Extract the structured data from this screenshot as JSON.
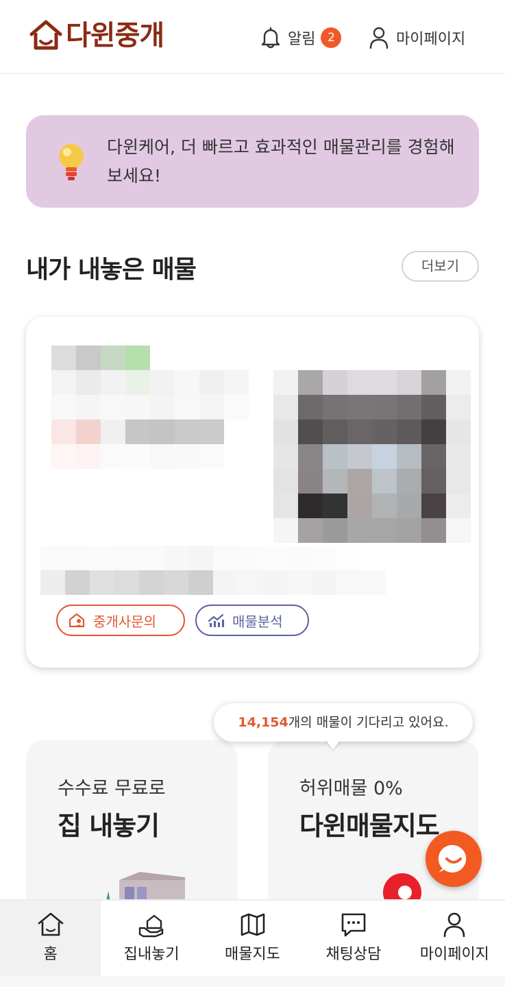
{
  "header": {
    "logo_text": "다윈중개",
    "alarm_label": "알림",
    "alarm_count": "2",
    "mypage_label": "마이페이지"
  },
  "promo": {
    "text": "다윈케어, 더 빠르고 효과적인 매물관리를 경험해보세요!"
  },
  "my_listings": {
    "title": "내가 내놓은 매물",
    "more_label": "더보기",
    "card": {
      "office_inquiry_label": "중개사문의",
      "analysis_label": "매물분석"
    }
  },
  "tooltip": {
    "count": "14,154",
    "suffix": "개의 매물이 기다리고 있어요."
  },
  "features": [
    {
      "subtitle": "수수료 무료로",
      "title": "집 내놓기"
    },
    {
      "subtitle": "허위매물 0%",
      "title": "다윈매물지도"
    }
  ],
  "bottom_nav": [
    {
      "label": "홈",
      "icon": "home-icon",
      "active": true
    },
    {
      "label": "집내놓기",
      "icon": "hand-house-icon",
      "active": false
    },
    {
      "label": "매물지도",
      "icon": "map-icon",
      "active": false
    },
    {
      "label": "채팅상담",
      "icon": "chat-icon",
      "active": false
    },
    {
      "label": "마이페이지",
      "icon": "user-icon",
      "active": false
    }
  ],
  "colors": {
    "brand": "#8a2b14",
    "accent": "#f05a28",
    "promo_bg": "#e2c9e2",
    "analysis": "#5a63a0"
  }
}
